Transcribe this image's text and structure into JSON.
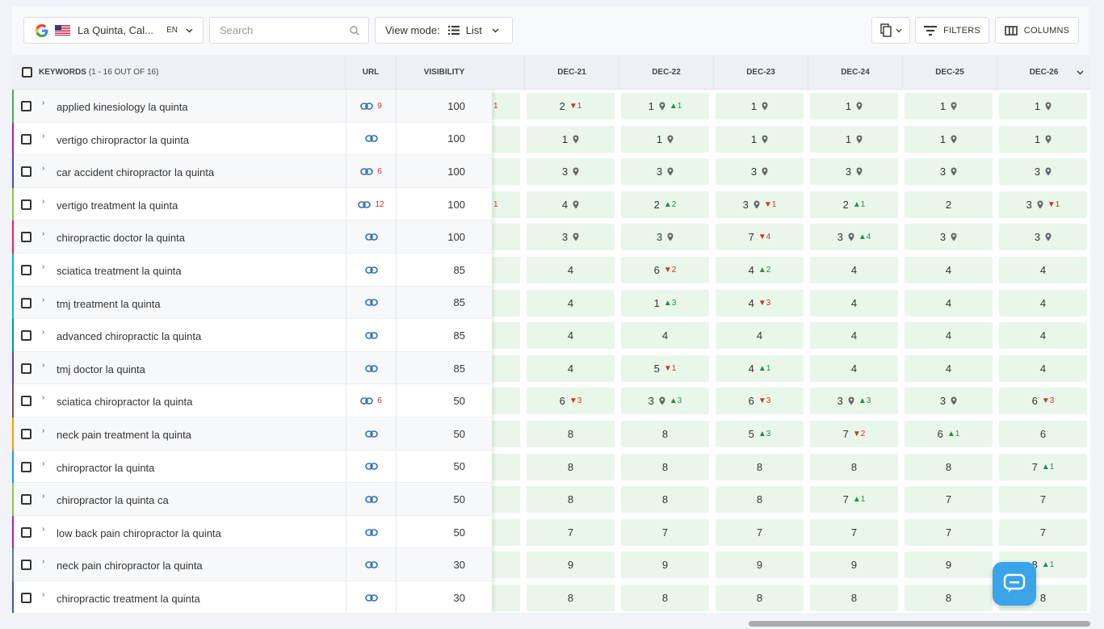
{
  "toolbar": {
    "location": "La Quinta, Cal...",
    "lang": "EN",
    "search_placeholder": "Search",
    "view_mode_label": "View mode:",
    "view_mode_value": "List",
    "filters_label": "FILTERS",
    "columns_label": "COLUMNS"
  },
  "table": {
    "keywords_header": "KEYWORDS",
    "keywords_count": "(1 - 16 OUT OF 16)",
    "url_header": "URL",
    "visibility_header": "VISIBILITY",
    "dates": [
      "DEC-21",
      "DEC-22",
      "DEC-23",
      "DEC-24",
      "DEC-25",
      "DEC-26"
    ],
    "rows": [
      {
        "keyword": "applied kinesiology la quinta",
        "url_count": "9",
        "visibility": "100",
        "stub": "1",
        "accent": "#4caf50",
        "cells": [
          {
            "v": "2",
            "dn": "1"
          },
          {
            "v": "1",
            "pin": true,
            "up": "1"
          },
          {
            "v": "1",
            "pin": true
          },
          {
            "v": "1",
            "pin": true
          },
          {
            "v": "1",
            "pin": true
          },
          {
            "v": "1",
            "pin": true
          }
        ]
      },
      {
        "keyword": "vertigo chiropractor la quinta",
        "url_count": "",
        "visibility": "100",
        "stub": "",
        "accent": "#9c27b0",
        "cells": [
          {
            "v": "1",
            "pin": true
          },
          {
            "v": "1",
            "pin": true
          },
          {
            "v": "1",
            "pin": true
          },
          {
            "v": "1",
            "pin": true
          },
          {
            "v": "1",
            "pin": true
          },
          {
            "v": "1",
            "pin": true
          }
        ]
      },
      {
        "keyword": "car accident chiropractor la quinta",
        "url_count": "6",
        "visibility": "100",
        "stub": "",
        "accent": "#3f51b5",
        "cells": [
          {
            "v": "3",
            "pin": true
          },
          {
            "v": "3",
            "pin": true
          },
          {
            "v": "3",
            "pin": true
          },
          {
            "v": "3",
            "pin": true
          },
          {
            "v": "3",
            "pin": true
          },
          {
            "v": "3",
            "pin": true
          }
        ]
      },
      {
        "keyword": "vertigo treatment la quinta",
        "url_count": "12",
        "visibility": "100",
        "stub": "1",
        "accent": "#8bc34a",
        "cells": [
          {
            "v": "4",
            "pin": true
          },
          {
            "v": "2",
            "up": "2"
          },
          {
            "v": "3",
            "pin": true,
            "dn": "1"
          },
          {
            "v": "2",
            "up": "1"
          },
          {
            "v": "2"
          },
          {
            "v": "3",
            "pin": true,
            "dn": "1"
          }
        ]
      },
      {
        "keyword": "chiropractic doctor la quinta",
        "url_count": "",
        "visibility": "100",
        "stub": "",
        "accent": "#e91e63",
        "cells": [
          {
            "v": "3",
            "pin": true
          },
          {
            "v": "3",
            "pin": true
          },
          {
            "v": "7",
            "dn": "4"
          },
          {
            "v": "3",
            "pin": true,
            "up": "4"
          },
          {
            "v": "3",
            "pin": true
          },
          {
            "v": "3",
            "pin": true
          }
        ]
      },
      {
        "keyword": "sciatica treatment la quinta",
        "url_count": "",
        "visibility": "85",
        "stub": "",
        "accent": "#03a9f4",
        "cells": [
          {
            "v": "4"
          },
          {
            "v": "6",
            "dn": "2"
          },
          {
            "v": "4",
            "up": "2"
          },
          {
            "v": "4"
          },
          {
            "v": "4"
          },
          {
            "v": "4"
          }
        ]
      },
      {
        "keyword": "tmj treatment la quinta",
        "url_count": "",
        "visibility": "85",
        "stub": "",
        "accent": "#00bcd4",
        "cells": [
          {
            "v": "4"
          },
          {
            "v": "1",
            "up": "3"
          },
          {
            "v": "4",
            "dn": "3"
          },
          {
            "v": "4"
          },
          {
            "v": "4"
          },
          {
            "v": "4"
          }
        ]
      },
      {
        "keyword": "advanced chiropractic la quinta",
        "url_count": "",
        "visibility": "85",
        "stub": "",
        "accent": "#009688",
        "cells": [
          {
            "v": "4"
          },
          {
            "v": "4"
          },
          {
            "v": "4"
          },
          {
            "v": "4"
          },
          {
            "v": "4"
          },
          {
            "v": "4"
          }
        ]
      },
      {
        "keyword": "tmj doctor la quinta",
        "url_count": "",
        "visibility": "85",
        "stub": "",
        "accent": "#673ab7",
        "cells": [
          {
            "v": "4"
          },
          {
            "v": "5",
            "dn": "1"
          },
          {
            "v": "4",
            "up": "1"
          },
          {
            "v": "4"
          },
          {
            "v": "4"
          },
          {
            "v": "4"
          }
        ]
      },
      {
        "keyword": "sciatica chiropractor la quinta",
        "url_count": "6",
        "visibility": "50",
        "stub": "",
        "accent": "#795548",
        "cells": [
          {
            "v": "6",
            "dn": "3"
          },
          {
            "v": "3",
            "pin": true,
            "up": "3"
          },
          {
            "v": "6",
            "dn": "3"
          },
          {
            "v": "3",
            "pin": true,
            "up": "3"
          },
          {
            "v": "3",
            "pin": true
          },
          {
            "v": "6",
            "dn": "3"
          }
        ]
      },
      {
        "keyword": "neck pain treatment la quinta",
        "url_count": "",
        "visibility": "50",
        "stub": "",
        "accent": "#ff9800",
        "cells": [
          {
            "v": "8"
          },
          {
            "v": "8"
          },
          {
            "v": "5",
            "up": "3"
          },
          {
            "v": "7",
            "dn": "2"
          },
          {
            "v": "6",
            "up": "1"
          },
          {
            "v": "6"
          }
        ]
      },
      {
        "keyword": "chiropractor la quinta",
        "url_count": "",
        "visibility": "50",
        "stub": "",
        "accent": "#2196f3",
        "cells": [
          {
            "v": "8"
          },
          {
            "v": "8"
          },
          {
            "v": "8"
          },
          {
            "v": "8"
          },
          {
            "v": "8"
          },
          {
            "v": "7",
            "up": "1"
          }
        ]
      },
      {
        "keyword": "chiropractor la quinta ca",
        "url_count": "",
        "visibility": "50",
        "stub": "",
        "accent": "#8bc34a",
        "cells": [
          {
            "v": "8"
          },
          {
            "v": "8"
          },
          {
            "v": "8"
          },
          {
            "v": "7",
            "up": "1"
          },
          {
            "v": "7"
          },
          {
            "v": "7"
          }
        ]
      },
      {
        "keyword": "low back pain chiropractor la quinta",
        "url_count": "",
        "visibility": "50",
        "stub": "",
        "accent": "#9c27b0",
        "cells": [
          {
            "v": "7"
          },
          {
            "v": "7"
          },
          {
            "v": "7"
          },
          {
            "v": "7"
          },
          {
            "v": "7"
          },
          {
            "v": "7"
          }
        ]
      },
      {
        "keyword": "neck pain chiropractor la quinta",
        "url_count": "",
        "visibility": "30",
        "stub": "",
        "accent": "#607d8b",
        "cells": [
          {
            "v": "9"
          },
          {
            "v": "9"
          },
          {
            "v": "9"
          },
          {
            "v": "9"
          },
          {
            "v": "9"
          },
          {
            "v": "8",
            "up": "1"
          }
        ]
      },
      {
        "keyword": "chiropractic treatment la quinta",
        "url_count": "",
        "visibility": "30",
        "stub": "",
        "accent": "#3f51b5",
        "cells": [
          {
            "v": "8"
          },
          {
            "v": "8"
          },
          {
            "v": "8"
          },
          {
            "v": "8"
          },
          {
            "v": "8"
          },
          {
            "v": "8"
          }
        ]
      }
    ]
  }
}
